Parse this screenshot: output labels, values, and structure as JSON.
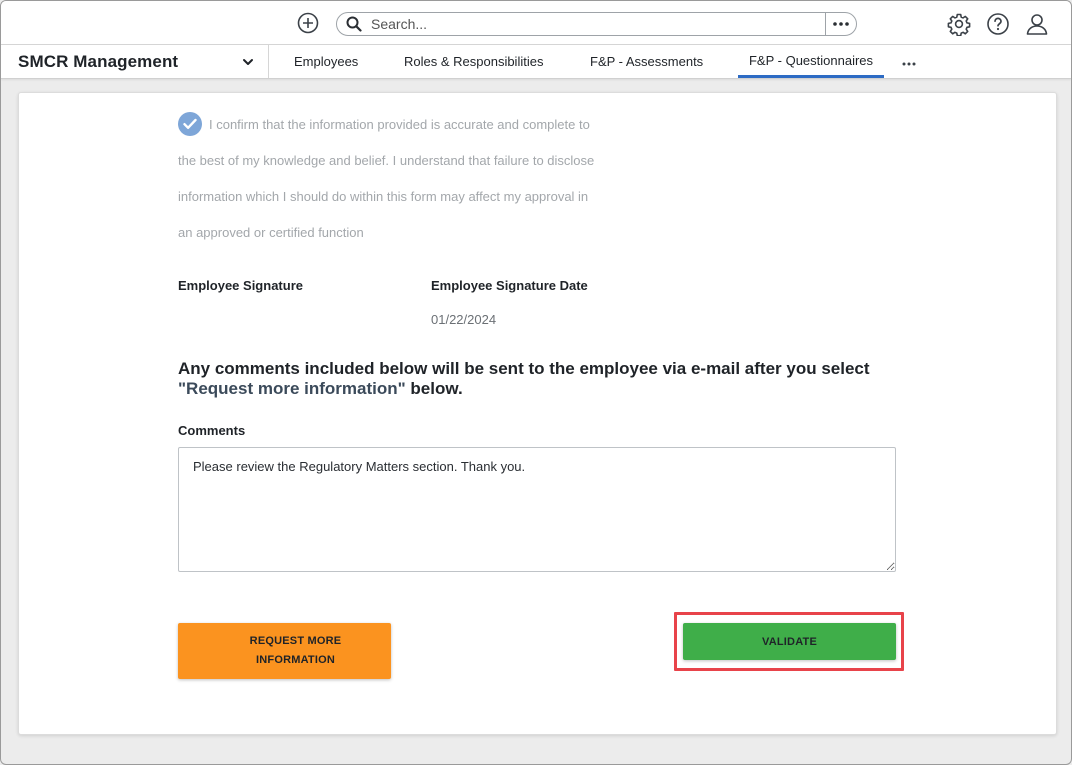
{
  "search": {
    "placeholder": "Search..."
  },
  "icons": {
    "add": "plus-circle-icon",
    "search": "magnifier-icon",
    "search_options": "ellipsis-icon",
    "settings": "gear-icon",
    "help": "question-circle-icon",
    "user": "user-icon",
    "app_menu": "chevron-down-icon",
    "confirm": "check-circle-icon",
    "more_tabs": "ellipsis-icon"
  },
  "app": {
    "name": "SMCR Management"
  },
  "nav": {
    "tabs": [
      {
        "label": "Employees",
        "active": false
      },
      {
        "label": "Roles & Responsibilities",
        "active": false
      },
      {
        "label": "F&P - Assessments",
        "active": false
      },
      {
        "label": "F&P - Questionnaires",
        "active": true
      }
    ]
  },
  "form": {
    "confirmation": {
      "checked": true,
      "lines": [
        "I confirm that the information provided is accurate and complete to",
        "the best of my knowledge and belief. I understand that failure to disclose",
        "information which I should do within this form may affect my approval in",
        "an approved or certified function"
      ]
    },
    "employee_signature_label": "Employee Signature",
    "employee_signature_date_label": "Employee Signature Date",
    "employee_signature_date_value": "01/22/2024",
    "notice": {
      "prefix": "Any comments included below will be sent to the employee via e-mail after you select",
      "highlight": "\"Request more information\"",
      "suffix": " below."
    },
    "comments_label": "Comments",
    "comments_value": "Please review the Regulatory Matters section. Thank you."
  },
  "actions": {
    "request_more_info": "REQUEST MORE INFORMATION",
    "validate": "VALIDATE"
  },
  "colors": {
    "accent": "#2d6bc4",
    "request_button": "#fb931f",
    "validate_button": "#3fae49",
    "highlight": "#e8434a",
    "checkbox": "#7ea6d8"
  }
}
